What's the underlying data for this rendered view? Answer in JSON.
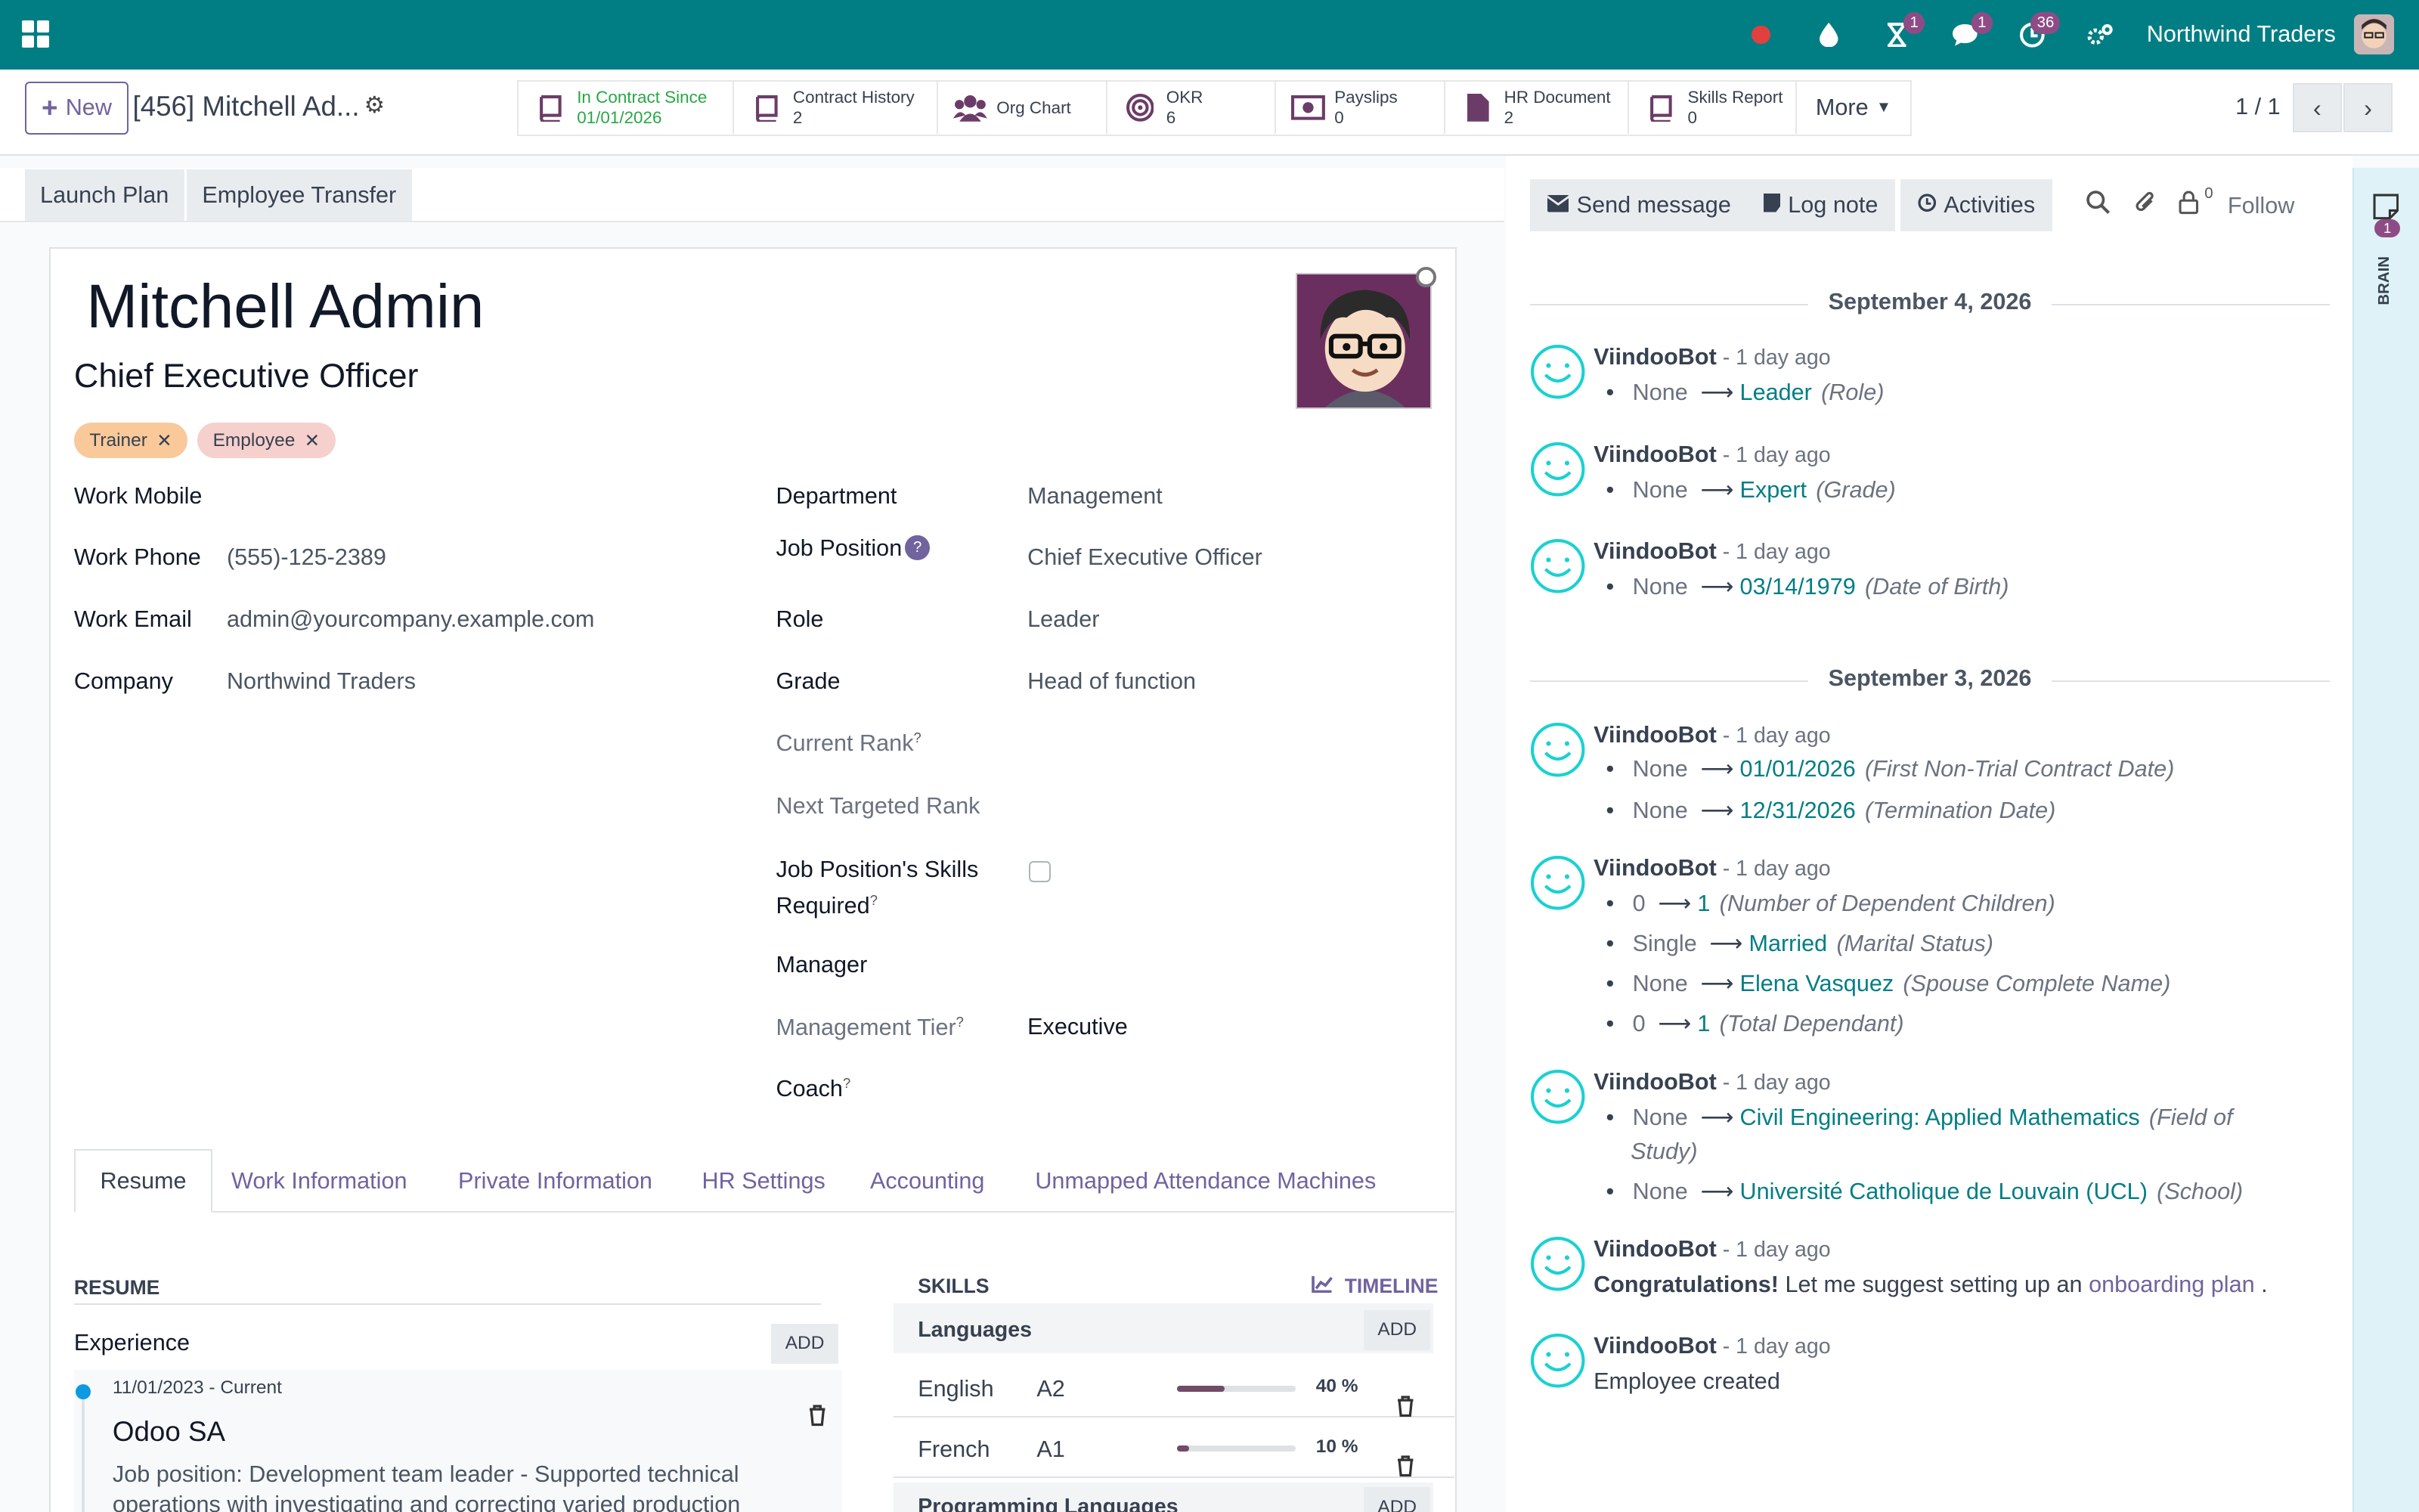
{
  "navbar": {
    "company": "Northwind Traders",
    "badges": {
      "activity": "1",
      "messages": "1",
      "timer": "36"
    },
    "icons": [
      "apps-icon",
      "record-icon",
      "drop-icon",
      "hourglass-icon",
      "chat-icon",
      "clock-icon",
      "settings-icon",
      "avatar"
    ]
  },
  "control": {
    "new_label": "New",
    "record_title": "[456] Mitchell Ad...",
    "pager": "1 / 1",
    "more_label": "More",
    "smart_buttons": [
      {
        "label": "In Contract Since",
        "value": "01/01/2026"
      },
      {
        "label": "Contract History",
        "value": "2"
      },
      {
        "label": "Org Chart",
        "value": ""
      },
      {
        "label": "OKR",
        "value": "6"
      },
      {
        "label": "Payslips",
        "value": "0"
      },
      {
        "label": "HR Document",
        "value": "2"
      },
      {
        "label": "Skills Report",
        "value": "0"
      }
    ]
  },
  "statusbar": {
    "launch_plan": "Launch Plan",
    "employee_transfer": "Employee Transfer"
  },
  "employee": {
    "name": "Mitchell Admin",
    "job_title": "Chief Executive Officer",
    "tags": [
      "Trainer",
      "Employee"
    ],
    "left_fields": [
      {
        "label": "Work Mobile",
        "value": ""
      },
      {
        "label": "Work Phone",
        "value": "(555)-125-2389"
      },
      {
        "label": "Work Email",
        "value": "admin@yourcompany.example.com"
      },
      {
        "label": "Company",
        "value": "Northwind Traders"
      }
    ],
    "right_fields": {
      "department": {
        "label": "Department",
        "value": "Management"
      },
      "job_position": {
        "label": "Job Position",
        "value": "Chief Executive Officer"
      },
      "role": {
        "label": "Role",
        "value": "Leader"
      },
      "grade": {
        "label": "Grade",
        "value": "Head of function"
      },
      "current_rank": {
        "label": "Current Rank",
        "value": ""
      },
      "next_rank": {
        "label": "Next Targeted Rank",
        "value": ""
      },
      "skills_required_1": {
        "label": "Job Position's Skills"
      },
      "skills_required_2": {
        "label": "Required"
      },
      "manager": {
        "label": "Manager",
        "value": ""
      },
      "management_tier": {
        "label": "Management Tier",
        "value": "Executive"
      },
      "coach": {
        "label": "Coach",
        "value": ""
      }
    }
  },
  "tabs": [
    "Resume",
    "Work Information",
    "Private Information",
    "HR Settings",
    "Accounting",
    "Unmapped Attendance Machines"
  ],
  "resume": {
    "title": "RESUME",
    "experience_label": "Experience",
    "add_label": "ADD",
    "item": {
      "dates": "11/01/2023 - Current",
      "company": "Odoo SA",
      "desc_1": "Job position: Development team leader - Supported technical",
      "desc_2": "operations with investigating and correcting varied production"
    }
  },
  "skills": {
    "title": "SKILLS",
    "timeline_label": "TIMELINE",
    "groups": [
      {
        "name": "Languages",
        "add": "ADD"
      },
      {
        "name": "Programming Languages",
        "add": "ADD"
      }
    ],
    "rows": [
      {
        "skill": "English",
        "level": "A2",
        "progress": 40,
        "progress_label": "40 %"
      },
      {
        "skill": "French",
        "level": "A1",
        "progress": 10,
        "progress_label": "10 %"
      }
    ]
  },
  "chatter": {
    "send_message": "Send message",
    "log_note": "Log note",
    "activities": "Activities",
    "follow": "Follow",
    "followers_count": "0",
    "dates": [
      "September 4, 2026",
      "September 3, 2026"
    ],
    "author": "ViindooBot",
    "ago": " - 1 day ago",
    "messages": [
      {
        "changes": [
          {
            "old": "None",
            "new": "Leader",
            "field": "(Role)"
          }
        ]
      },
      {
        "changes": [
          {
            "old": "None",
            "new": "Expert",
            "field": "(Grade)"
          }
        ]
      },
      {
        "changes": [
          {
            "old": "None",
            "new": "03/14/1979",
            "field": "(Date of Birth)"
          }
        ]
      },
      {
        "changes": [
          {
            "old": "None",
            "new": "01/01/2026",
            "field": "(First Non-Trial Contract Date)"
          },
          {
            "old": "None",
            "new": "12/31/2026",
            "field": "(Termination Date)"
          }
        ]
      },
      {
        "changes": [
          {
            "old": "0",
            "new": "1",
            "field": "(Number of Dependent Children)"
          },
          {
            "old": "Single",
            "new": "Married",
            "field": "(Marital Status)"
          },
          {
            "old": "None",
            "new": "Elena Vasquez",
            "field": "(Spouse Complete Name)"
          },
          {
            "old": "0",
            "new": "1",
            "field": "(Total Dependant)"
          }
        ]
      },
      {
        "changes": [
          {
            "old": "None",
            "new": "Civil Engineering: Applied Mathematics",
            "field": "(Field of",
            "field_cont": "Study)"
          },
          {
            "old": "None",
            "new": "Université Catholique de Louvain (UCL)",
            "field": "(School)"
          }
        ]
      }
    ],
    "congrats_bold": "Congratulations!",
    "congrats_text": " Let me suggest setting up an ",
    "congrats_link": "onboarding plan",
    "congrats_end": " .",
    "created": "Employee created"
  },
  "brain": {
    "label": "BRAIN",
    "badge": "1"
  },
  "colors": {
    "navbar": "#017e84",
    "primary": "#71639e",
    "link": "#017e84",
    "tag_trainer": "#f9c99a",
    "tag_employee": "#f6d0cc"
  }
}
